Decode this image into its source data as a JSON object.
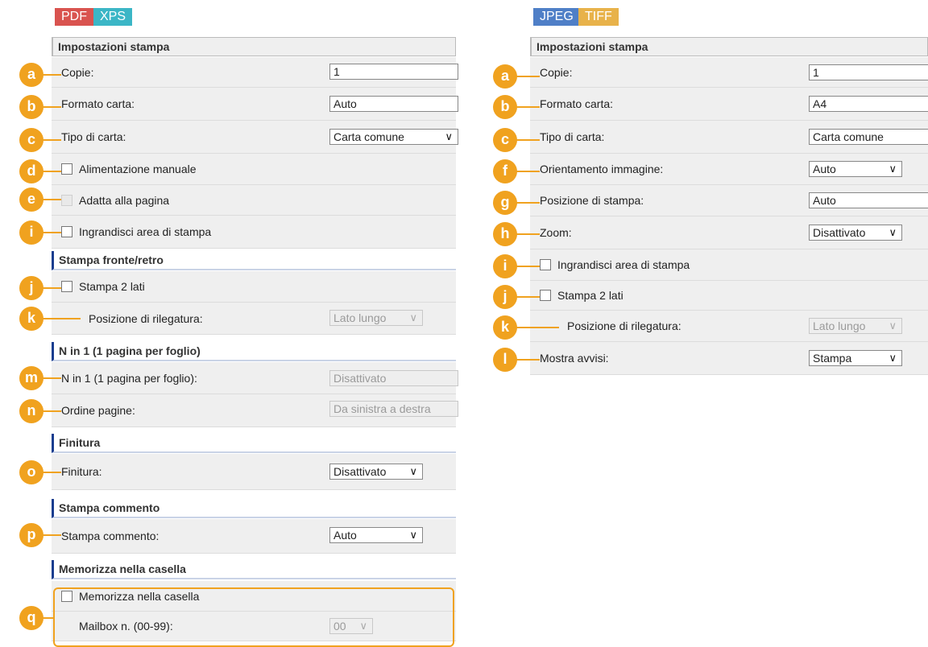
{
  "colors": {
    "accent": "#f0a21f",
    "pdf": "#d9534f",
    "xps": "#3bb6c6",
    "jpeg": "#4f7fc7",
    "tiff": "#e8b24a",
    "section": "#1a3d8f"
  },
  "left": {
    "tags": [
      "PDF",
      "XPS"
    ],
    "header": "Impostazioni stampa",
    "copies": {
      "label": "Copie:",
      "value": "1"
    },
    "paper_size": {
      "label": "Formato carta:",
      "value": "Auto"
    },
    "paper_type": {
      "label": "Tipo di carta:",
      "value": "Carta comune"
    },
    "manual_feed": {
      "label": "Alimentazione manuale"
    },
    "fit_page": {
      "label": "Adatta alla pagina"
    },
    "enlarge_area": {
      "label": "Ingrandisci area di stampa"
    },
    "duplex_section": "Stampa fronte/retro",
    "two_sided": {
      "label": "Stampa 2 lati"
    },
    "binding": {
      "label": "Posizione di rilegatura:",
      "value": "Lato lungo"
    },
    "nin1_section": "N in 1 (1 pagina per foglio)",
    "nin1": {
      "label": "N in 1 (1 pagina per foglio):",
      "value": "Disattivato"
    },
    "page_order": {
      "label": "Ordine pagine:",
      "value": "Da sinistra a destra"
    },
    "finishing_section": "Finitura",
    "finishing": {
      "label": "Finitura:",
      "value": "Disattivato"
    },
    "comment_section": "Stampa commento",
    "comment": {
      "label": "Stampa commento:",
      "value": "Auto"
    },
    "mailbox_section": "Memorizza nella casella",
    "store_box": {
      "label": "Memorizza nella casella"
    },
    "mailbox": {
      "label": "Mailbox n. (00-99):",
      "value": "00"
    }
  },
  "right": {
    "tags": [
      "JPEG",
      "TIFF"
    ],
    "header": "Impostazioni stampa",
    "copies": {
      "label": "Copie:",
      "value": "1"
    },
    "paper_size": {
      "label": "Formato carta:",
      "value": "A4"
    },
    "paper_type": {
      "label": "Tipo di carta:",
      "value": "Carta comune"
    },
    "orientation": {
      "label": "Orientamento immagine:",
      "value": "Auto"
    },
    "position": {
      "label": "Posizione di stampa:",
      "value": "Auto"
    },
    "zoom": {
      "label": "Zoom:",
      "value": "Disattivato"
    },
    "enlarge_area": {
      "label": "Ingrandisci area di stampa"
    },
    "two_sided": {
      "label": "Stampa 2 lati"
    },
    "binding": {
      "label": "Posizione di rilegatura:",
      "value": "Lato lungo"
    },
    "warnings": {
      "label": "Mostra avvisi:",
      "value": "Stampa"
    }
  },
  "badges": {
    "a": "a",
    "b": "b",
    "c": "c",
    "d": "d",
    "e": "e",
    "f": "f",
    "g": "g",
    "h": "h",
    "i": "i",
    "j": "j",
    "k": "k",
    "l": "l",
    "m": "m",
    "n": "n",
    "o": "o",
    "p": "p",
    "q": "q"
  }
}
